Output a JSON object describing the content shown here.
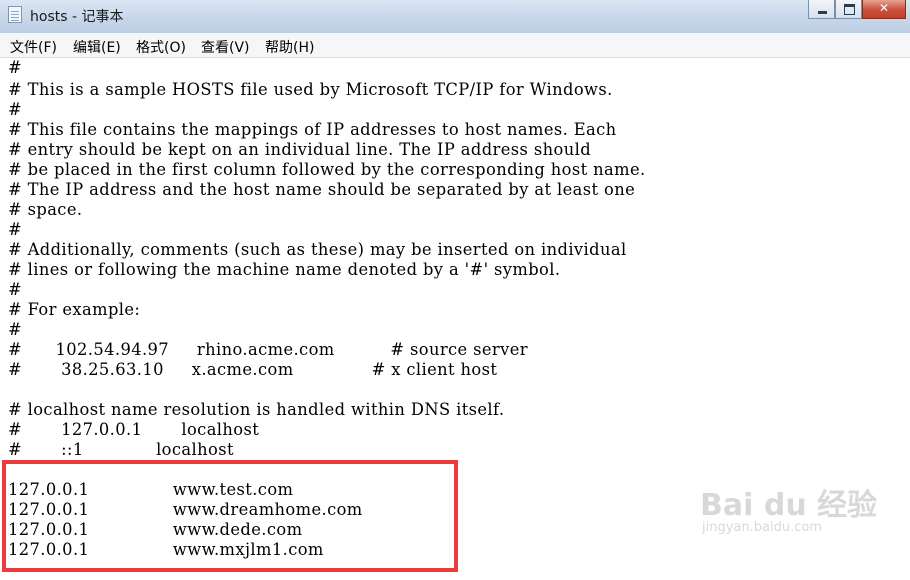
{
  "window": {
    "title": "hosts - 记事本"
  },
  "menu": {
    "items": [
      {
        "label": "文件(F)"
      },
      {
        "label": "编辑(E)"
      },
      {
        "label": "格式(O)"
      },
      {
        "label": "查看(V)"
      },
      {
        "label": "帮助(H)"
      }
    ]
  },
  "editor": {
    "lines": [
      "#",
      "# This is a sample HOSTS file used by Microsoft TCP/IP for Windows.",
      "#",
      "# This file contains the mappings of IP addresses to host names. Each",
      "# entry should be kept on an individual line. The IP address should",
      "# be placed in the first column followed by the corresponding host name.",
      "# The IP address and the host name should be separated by at least one",
      "# space.",
      "#",
      "# Additionally, comments (such as these) may be inserted on individual",
      "# lines or following the machine name denoted by a '#' symbol.",
      "#",
      "# For example:",
      "#",
      "#      102.54.94.97     rhino.acme.com          # source server",
      "#       38.25.63.10     x.acme.com              # x client host",
      "",
      "# localhost name resolution is handled within DNS itself.",
      "#       127.0.0.1       localhost",
      "#       ::1             localhost",
      "",
      "127.0.0.1               www.test.com",
      "127.0.0.1               www.dreamhome.com",
      "127.0.0.1               www.dede.com",
      "127.0.0.1               www.mxjlm1.com"
    ]
  },
  "watermark": {
    "brand": "Bai du 经验",
    "url": "jingyan.baidu.com"
  },
  "colors": {
    "highlight_border": "#ee3b3b",
    "titlebar": "#c6d6ea",
    "menubar": "#f5f6f7"
  }
}
